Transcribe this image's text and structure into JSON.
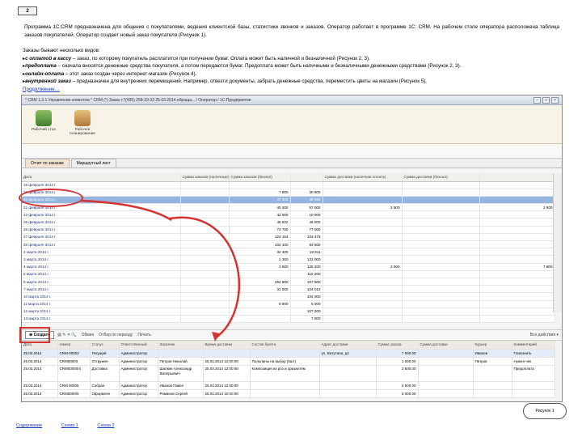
{
  "page_number": "2",
  "intro_text": "Программа 1С:CRM предназначена для общения с покупателями, ведения клиентской базы, статистики звонков и заказов. Оператор работает в программе 1С: CRM. На рабочем столе оператора расположена таблица заказов покупателей. Оператор создает новый заказ покупателя (Рисунок 1).",
  "types_heading": "Заказы бывают несколько видов:",
  "types": [
    {
      "term": "с оплатой в кассу",
      "text": " – заказ, по которому покупатель расплатится при получении бумаг. Оплата может быть наличной и безналичной (Рисунок 2, 3)."
    },
    {
      "term": "предоплата",
      "text": " – сначала вносятся денежные средства покупателя, а потом передаются бумаг. Предоплата может быть наличными и безналичными денежными средствами (Рисунок 2, 3)."
    },
    {
      "term": "онлайн-оплата",
      "text": " – этот заказ создан через интернет-магазин (Рисунок 4)."
    },
    {
      "term": "внутренний заказ",
      "text": " – предназначен для внутренних перемещений. Например, отвезти документы, забрать денежные средства, переместить цветы на магазин (Рисунок 5)."
    }
  ],
  "more_link": "Продолжение…",
  "window_title": "* CRM 1.3.1 Управление клиентом * CRM (*) Заказ +7(495) 258-33-33 25.03.2014 обраща... / Оператор / 1С:Предприятие",
  "ribbon": [
    {
      "label": "Рабочий стол",
      "icon": "desktop-icon"
    },
    {
      "label": "Рабочее планирование",
      "icon": "planning-icon"
    }
  ],
  "tabs": [
    "Отчет по заказам",
    "Маршрутный лист"
  ],
  "grid1": {
    "headers": [
      "Дата",
      "Сумма заказов (наличные)",
      "Сумма заказов (безнал)",
      "",
      "Сумма доставки (наличная оплата)",
      "Сумма доставки (безнал)",
      ""
    ],
    "rows": [
      [
        "18 февраля 2014 г.",
        "",
        "",
        "",
        "",
        "",
        ""
      ],
      [
        "19 февраля 2014 г.",
        "",
        "7 800",
        "30 800",
        "",
        "",
        ""
      ],
      [
        "20 февраля 2014 г.",
        "",
        "37 400",
        "39 450",
        "",
        "",
        ""
      ],
      [
        "21 февраля 2014 г.",
        "",
        "40 200",
        "57 000",
        "2 500",
        "",
        "2 500"
      ],
      [
        "22 февраля 2014 г.",
        "",
        "42 000",
        "10 000",
        "",
        "",
        ""
      ],
      [
        "25 февраля 2014 г.",
        "",
        "46 822",
        "46 000",
        "",
        "",
        ""
      ],
      [
        "26 февраля 2014 г.",
        "",
        "73 700",
        "77 000",
        "",
        "",
        ""
      ],
      [
        "27 февраля 2014 г.",
        "",
        "123 154",
        "103 478",
        "",
        "",
        ""
      ],
      [
        "28 февраля 2014 г.",
        "",
        "102 100",
        "92 500",
        "",
        "",
        ""
      ],
      [
        "2 марта 2014 г.",
        "",
        "32 400",
        "19 911",
        "",
        "",
        ""
      ],
      [
        "3 марта 2014 г.",
        "",
        "1 300",
        "131 000",
        "",
        "",
        ""
      ],
      [
        "4 марта 2014 г.",
        "",
        "3 500",
        "125 200",
        "3 500",
        "",
        "7 800"
      ],
      [
        "5 марта 2014 г.",
        "",
        "",
        "110 200",
        "",
        "",
        ""
      ],
      [
        "6 марта 2014 г.",
        "",
        "254 800",
        "107 500",
        "",
        "",
        ""
      ],
      [
        "7 марта 2014 г.",
        "",
        "31 000",
        "104 012",
        "",
        "",
        ""
      ],
      [
        "10 марта 2014 г.",
        "",
        "",
        "104 000",
        "",
        "",
        ""
      ],
      [
        "11 марта 2014 г.",
        "",
        "8 800",
        "5 000",
        "",
        "",
        ""
      ],
      [
        "12 марта 2014 г.",
        "",
        "",
        "107 200",
        "",
        "",
        ""
      ],
      [
        "13 марта 2014 г.",
        "",
        "",
        "7 000",
        "",
        "",
        ""
      ]
    ]
  },
  "toolbar2": {
    "create": "Создать",
    "items": [
      "Обмен",
      "Отбор по периоду",
      "Печать"
    ],
    "right": "Все действия ▾"
  },
  "grid2": {
    "headers": [
      "Дата",
      "Номер",
      "Статус",
      "Ответственный",
      "Заказчик",
      "Время доставки",
      "Состав букета",
      "Адрес доставки",
      "Сумма заказа",
      "Сумма доставки",
      "Курьер",
      "Комментарий"
    ],
    "rows": [
      [
        "25.03.2014",
        "CRM-00002",
        "Текущий",
        "Администратор",
        "",
        "",
        "",
        "ул. Ватутина, д4",
        "7 000.00",
        "",
        "Иванов",
        "Позвонить"
      ],
      [
        "25.03.2014",
        "CRM00003",
        "Отгружен",
        "Администратор",
        "Петров Николай",
        "25.03.2014 12:00:00",
        "Тюльпаны на выбор (5шт)",
        "",
        "1 000.00",
        "",
        "Петров",
        "Нужен чек"
      ],
      [
        "25.03.2014",
        "CRM00000/4",
        "Доставка",
        "Администратор",
        "Шапкин Александр Валерьевич",
        "25.03.2014 12:00:00",
        "Композиция из роз и хризантем",
        "",
        "2 500.00",
        "",
        "",
        "Предоплата"
      ],
      [
        "25.03.2014",
        "CRM 00005",
        "Собран",
        "Администратор",
        "Иванов Павел",
        "25.03.2014 12:00:00",
        "",
        "",
        "4 500.00",
        "",
        "",
        ""
      ],
      [
        "25.03.2014",
        "CRM0000/6",
        "Оформлен",
        "Администратор",
        "Романов Сергей",
        "25.03.2014 10:00:00",
        "",
        "",
        "5 000.00",
        "",
        "",
        ""
      ]
    ]
  },
  "figure_label": "Рисунок 1",
  "footer_links": [
    "Содержание",
    "Схема 1",
    "Схема 2"
  ],
  "colors": {
    "highlight": "#d53232",
    "selection": "#95b4de",
    "link": "#1a39b8"
  }
}
